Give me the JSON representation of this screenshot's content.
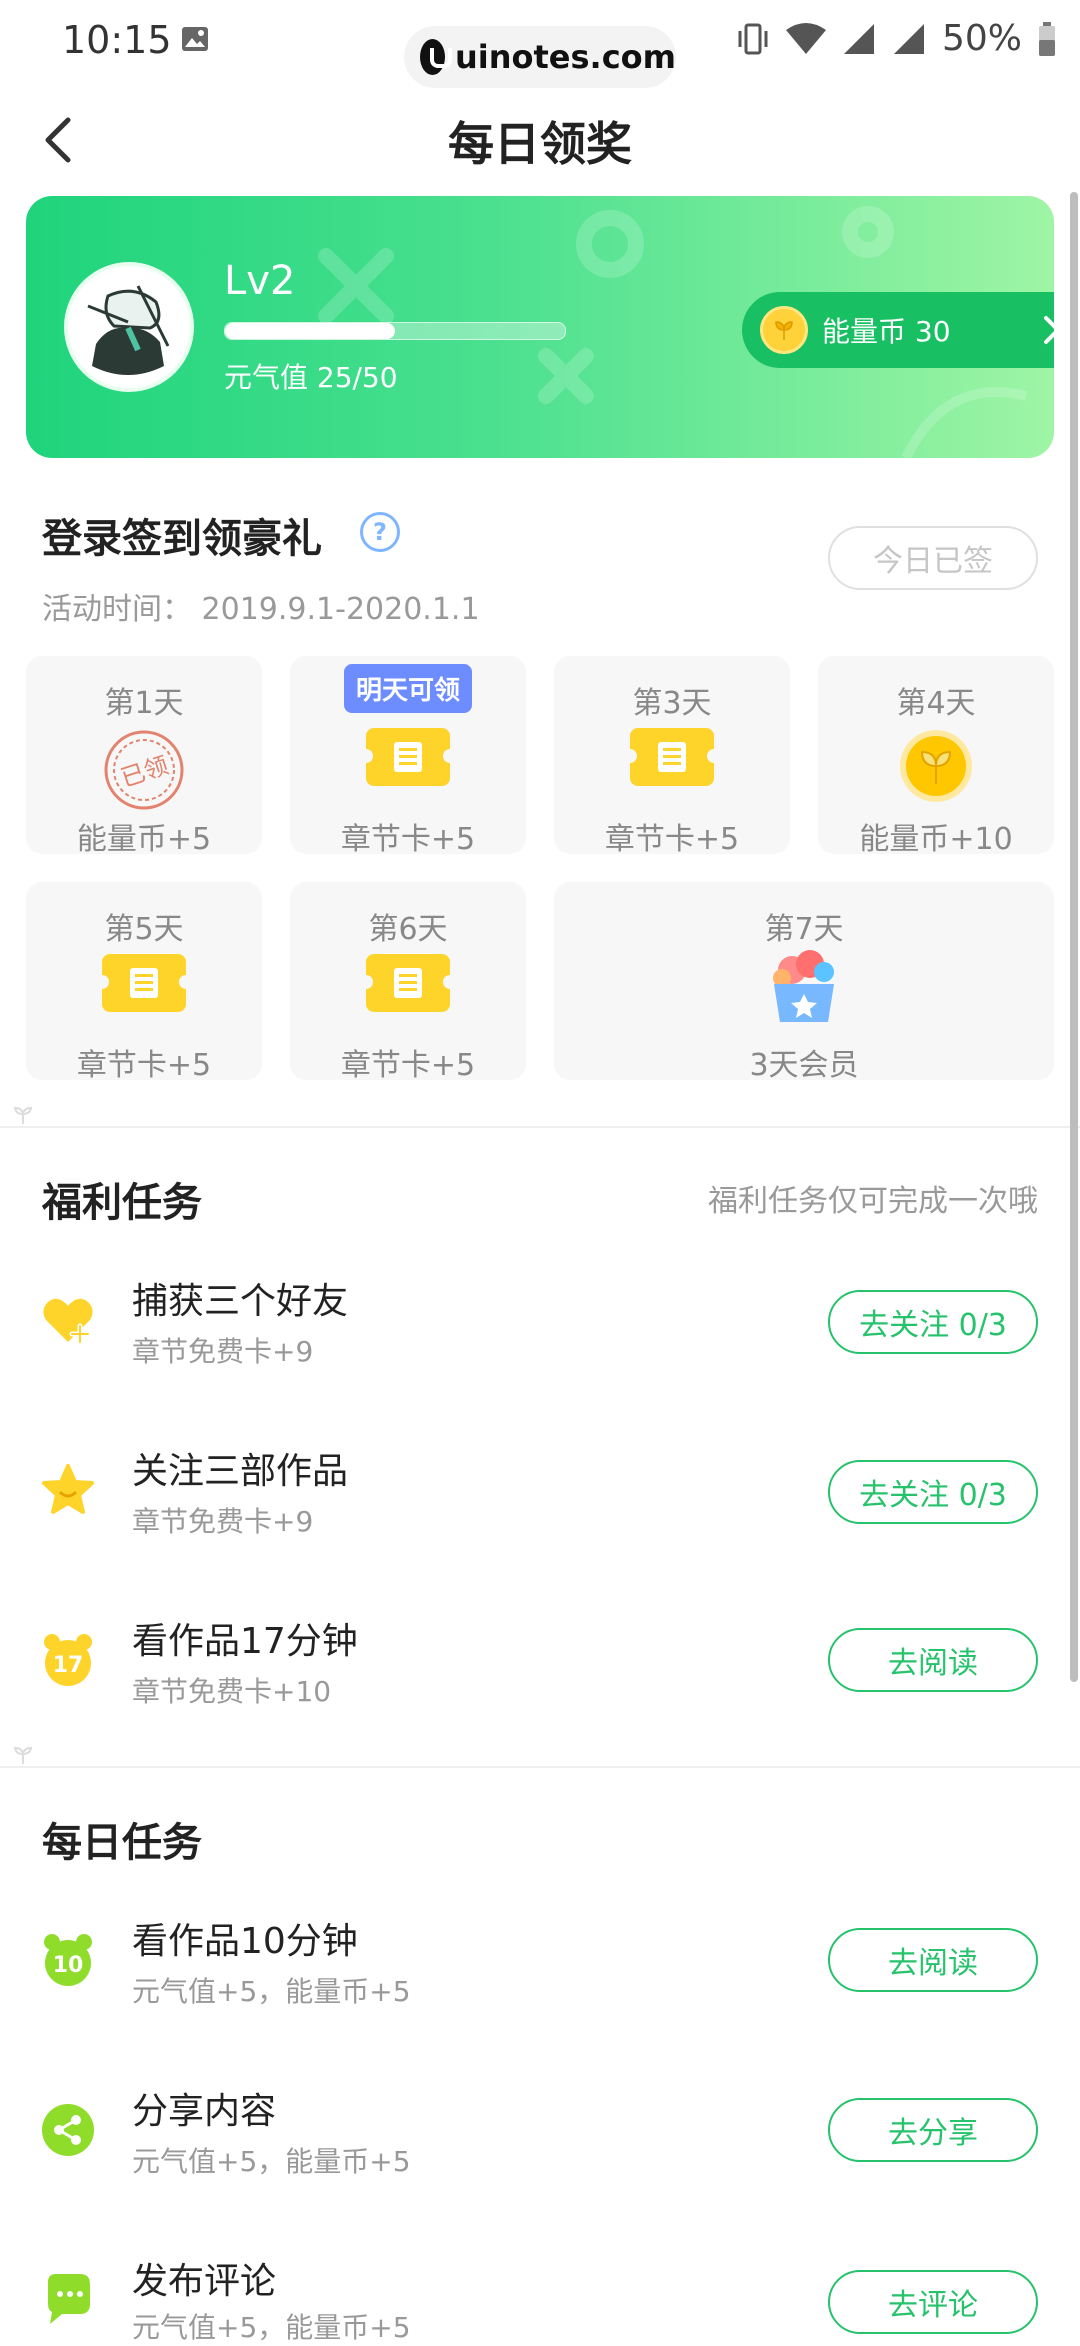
{
  "status_bar": {
    "time": "10:15",
    "watermark": "uinotes.com",
    "battery": "50%"
  },
  "header": {
    "title": "每日领奖"
  },
  "banner": {
    "level": "Lv2",
    "progress": 0.5,
    "vitality": "元气值 25/50",
    "coin_label": "能量币 30"
  },
  "signin": {
    "title": "登录签到领豪礼",
    "signed_button": "今日已签",
    "activity_time": "活动时间： 2019.9.1-2020.1.1",
    "tomorrow_badge": "明天可领",
    "days": [
      {
        "label": "第1天",
        "reward": "能量币+5",
        "icon": "stamp-icon"
      },
      {
        "label": "",
        "reward": "章节卡+5",
        "icon": "ticket-icon"
      },
      {
        "label": "第3天",
        "reward": "章节卡+5",
        "icon": "ticket-icon"
      },
      {
        "label": "第4天",
        "reward": "能量币+10",
        "icon": "coin-icon"
      },
      {
        "label": "第5天",
        "reward": "章节卡+5",
        "icon": "ticket-icon"
      },
      {
        "label": "第6天",
        "reward": "章节卡+5",
        "icon": "ticket-icon"
      },
      {
        "label": "第7天",
        "reward": "3天会员",
        "icon": "gift-basket-icon"
      }
    ]
  },
  "welfare": {
    "title": "福利任务",
    "note": "福利任务仅可完成一次哦",
    "tasks": [
      {
        "title": "捕获三个好友",
        "sub": "章节免费卡+9",
        "button": "去关注 0/3"
      },
      {
        "title": "关注三部作品",
        "sub": "章节免费卡+9",
        "button": "去关注 0/3"
      },
      {
        "title": "看作品17分钟",
        "sub": "章节免费卡+10",
        "button": "去阅读",
        "icon_text": "17"
      }
    ]
  },
  "daily": {
    "title": "每日任务",
    "tasks": [
      {
        "title": "看作品10分钟",
        "sub": "元气值+5，能量币+5",
        "button": "去阅读",
        "icon_text": "10"
      },
      {
        "title": "分享内容",
        "sub": "元气值+5，能量币+5",
        "button": "去分享"
      },
      {
        "title": "发布评论",
        "sub": "元气值+5，能量币+5",
        "button": "去评论"
      }
    ]
  },
  "colors": {
    "accent": "#27c26c",
    "banner_start": "#1fd47c",
    "banner_end": "#9ef5a5",
    "badge": "#6d8dff",
    "yellow": "#ffd42a"
  }
}
